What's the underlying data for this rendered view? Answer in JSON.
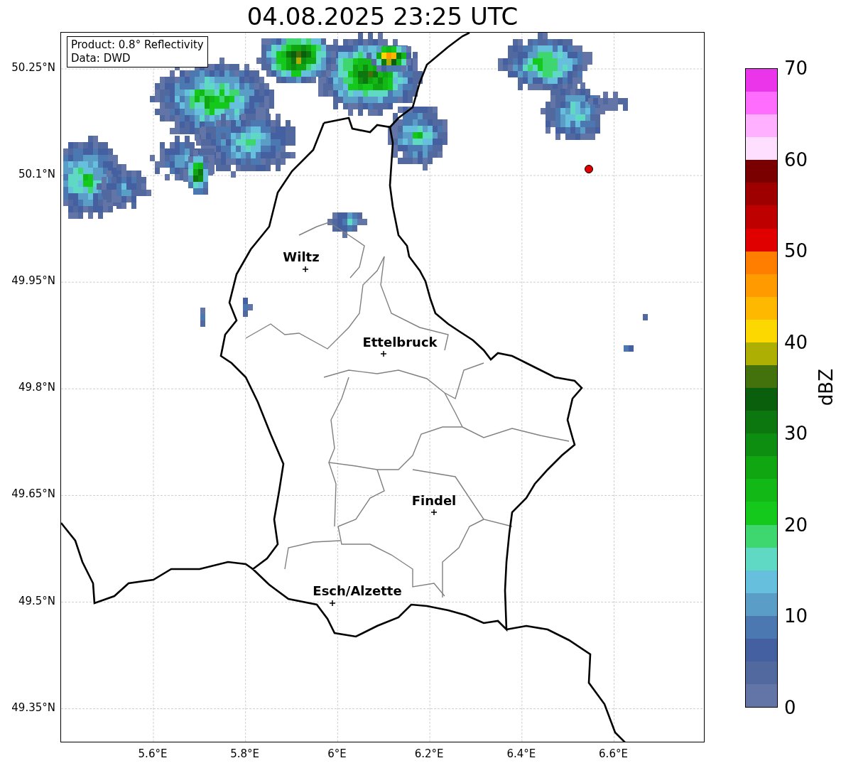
{
  "title": "04.08.2025 23:25 UTC",
  "info_box": [
    "Product: 0.8° Reflectivity",
    "Data: DWD"
  ],
  "map": {
    "lat_ticks": [
      "50.25°N",
      "50.1°N",
      "49.95°N",
      "49.8°N",
      "49.65°N",
      "49.5°N",
      "49.35°N"
    ],
    "lon_ticks": [
      "5.6°E",
      "5.8°E",
      "6°E",
      "6.2°E",
      "6.4°E",
      "6.6°E"
    ],
    "cities": [
      {
        "name": "Wiltz"
      },
      {
        "name": "Ettelbruck"
      },
      {
        "name": "Findel"
      },
      {
        "name": "Esch/Alzette"
      }
    ]
  },
  "colorbar": {
    "label": "dBZ",
    "ticks": [
      "70",
      "60",
      "50",
      "40",
      "30",
      "20",
      "10",
      "0"
    ],
    "bands": [
      {
        "color": "#ea35ea"
      },
      {
        "color": "#ff6dff"
      },
      {
        "color": "#ffb1ff"
      },
      {
        "color": "#ffdfff"
      },
      {
        "color": "#7a0000"
      },
      {
        "color": "#9e0000"
      },
      {
        "color": "#bf0000"
      },
      {
        "color": "#e00000"
      },
      {
        "color": "#ff7e00"
      },
      {
        "color": "#ff9b00"
      },
      {
        "color": "#feb800"
      },
      {
        "color": "#fdd700"
      },
      {
        "color": "#adb003"
      },
      {
        "color": "#43710c"
      },
      {
        "color": "#0a5f0d"
      },
      {
        "color": "#0c760f"
      },
      {
        "color": "#0e8e10"
      },
      {
        "color": "#0fa611"
      },
      {
        "color": "#11b816"
      },
      {
        "color": "#14c81c"
      },
      {
        "color": "#3dd66f"
      },
      {
        "color": "#5fd8c4"
      },
      {
        "color": "#66c0dd"
      },
      {
        "color": "#5a9dc6"
      },
      {
        "color": "#4b78b0"
      },
      {
        "color": "#4460a0"
      },
      {
        "color": "#52699f"
      },
      {
        "color": "#6375a6"
      }
    ]
  }
}
